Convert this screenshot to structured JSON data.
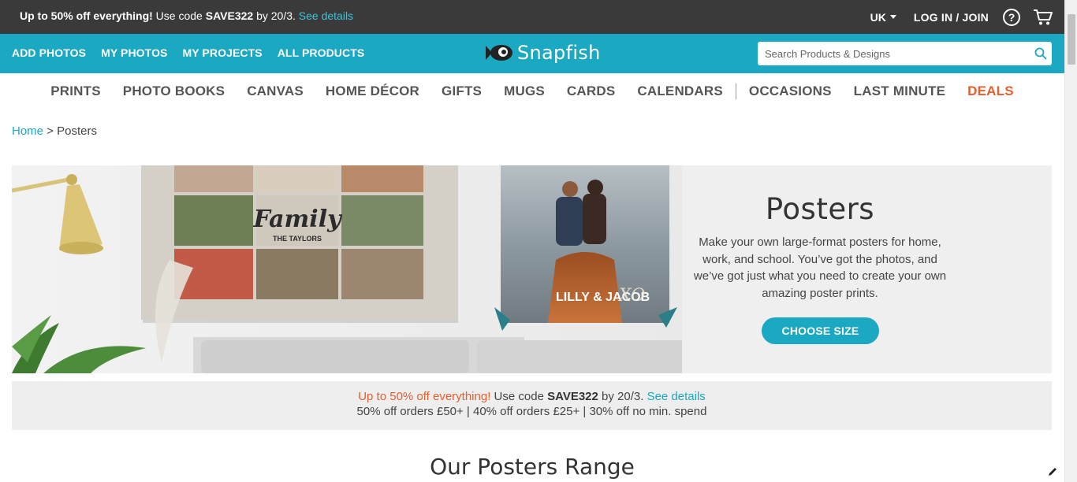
{
  "promo_bar": {
    "prefix": "Up to 50% off everything!",
    "text1": " Use code ",
    "code": "SAVE322",
    "text2": " by 20/3. ",
    "see_details": "See details",
    "region": "UK",
    "login": "LOG IN / JOIN",
    "help": "?"
  },
  "main_nav": {
    "items": [
      "ADD PHOTOS",
      "MY PHOTOS",
      "MY PROJECTS",
      "ALL PRODUCTS"
    ],
    "logo": "Snapfish",
    "search_placeholder": "Search Products & Designs"
  },
  "categories": {
    "items": [
      "PRINTS",
      "PHOTO BOOKS",
      "CANVAS",
      "HOME DÉCOR",
      "GIFTS",
      "MUGS",
      "CARDS",
      "CALENDARS"
    ],
    "items2": [
      "OCCASIONS",
      "LAST MINUTE",
      "DEALS"
    ]
  },
  "breadcrumb": {
    "home": "Home",
    "sep": " > ",
    "current": "Posters"
  },
  "hero": {
    "title": "Posters",
    "description": "Make your own large-format posters for home, work, and school. You’ve got the photos, and we’ve got just what you need to create your own amazing poster prints.",
    "button": "CHOOSE SIZE",
    "collage_title": "Family",
    "collage_subtitle": "THE TAYLORS",
    "poster_caption": "LILLY & JACOB",
    "poster_mark": "XO"
  },
  "promo_strip": {
    "red": "Up to 50% off everything!",
    "text1": " Use code ",
    "code": "SAVE322",
    "text2": " by 20/3. ",
    "see_details": "See details",
    "line2": "50% off orders £50+ | 40% off orders £25+ | 30% off no min. spend"
  },
  "range_title": "Our Posters Range",
  "colors": {
    "teal": "#1aa8c2",
    "dark_bar": "#3a3a3a",
    "deals_orange": "#e35f2e"
  }
}
